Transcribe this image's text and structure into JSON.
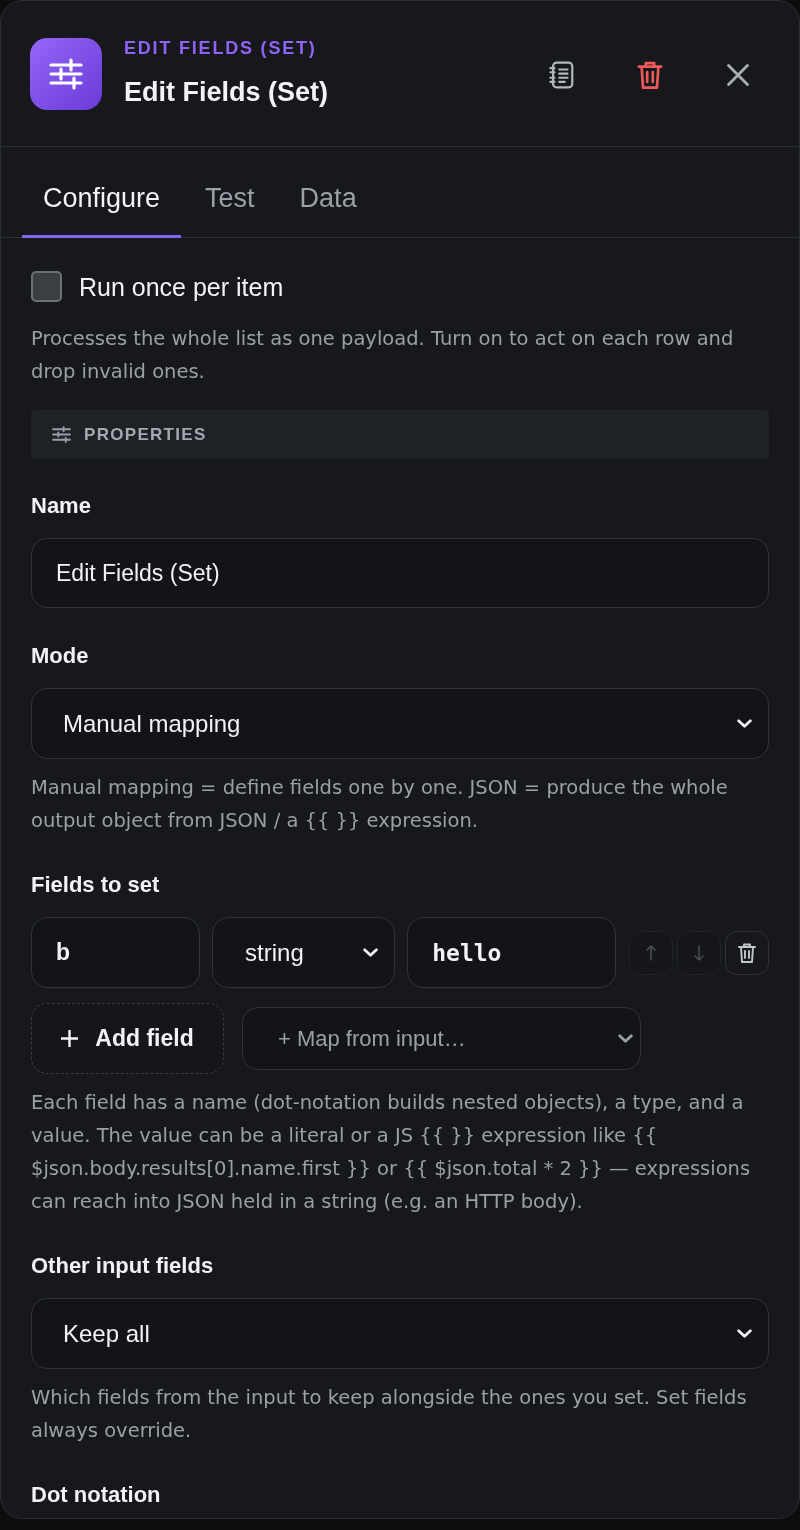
{
  "header": {
    "kicker": "EDIT FIELDS (SET)",
    "title": "Edit Fields (Set)"
  },
  "tabs": [
    {
      "label": "Configure",
      "selected": true
    },
    {
      "label": "Test",
      "selected": false
    },
    {
      "label": "Data",
      "selected": false
    }
  ],
  "run_once": {
    "label": "Run once per item",
    "checked": false,
    "help": "Processes the whole list as one payload. Turn on to act on each row and drop invalid ones."
  },
  "section": {
    "label": "PROPERTIES"
  },
  "name_field": {
    "label": "Name",
    "value": "Edit Fields (Set)"
  },
  "mode": {
    "label": "Mode",
    "value": "Manual mapping",
    "help": "Manual mapping = define fields one by one. JSON = produce the whole output object from JSON / a {{ }} expression."
  },
  "fields_to_set": {
    "label": "Fields to set",
    "rows": [
      {
        "name": "b",
        "type": "string",
        "value": "hello",
        "actions": [
          {
            "kind": "move_up",
            "disabled": true
          },
          {
            "kind": "move_down",
            "disabled": true
          },
          {
            "kind": "delete",
            "disabled": false
          }
        ]
      }
    ],
    "add_button": "Add field",
    "map_select": {
      "placeholder": "+ Map from input…"
    },
    "help": "Each field has a name (dot-notation builds nested objects), a type, and a value. The value can be a literal or a JS {{ }} expression like {{ $json.body.results[0].name.first }} or {{ $json.total * 2 }} — expressions can reach into JSON held in a string (e.g. an HTTP body)."
  },
  "other_fields": {
    "label": "Other input fields",
    "value": "Keep all",
    "help": "Which fields from the input to keep alongside the ones you set. Set fields always override."
  },
  "dot_notation": {
    "label": "Dot notation"
  }
}
